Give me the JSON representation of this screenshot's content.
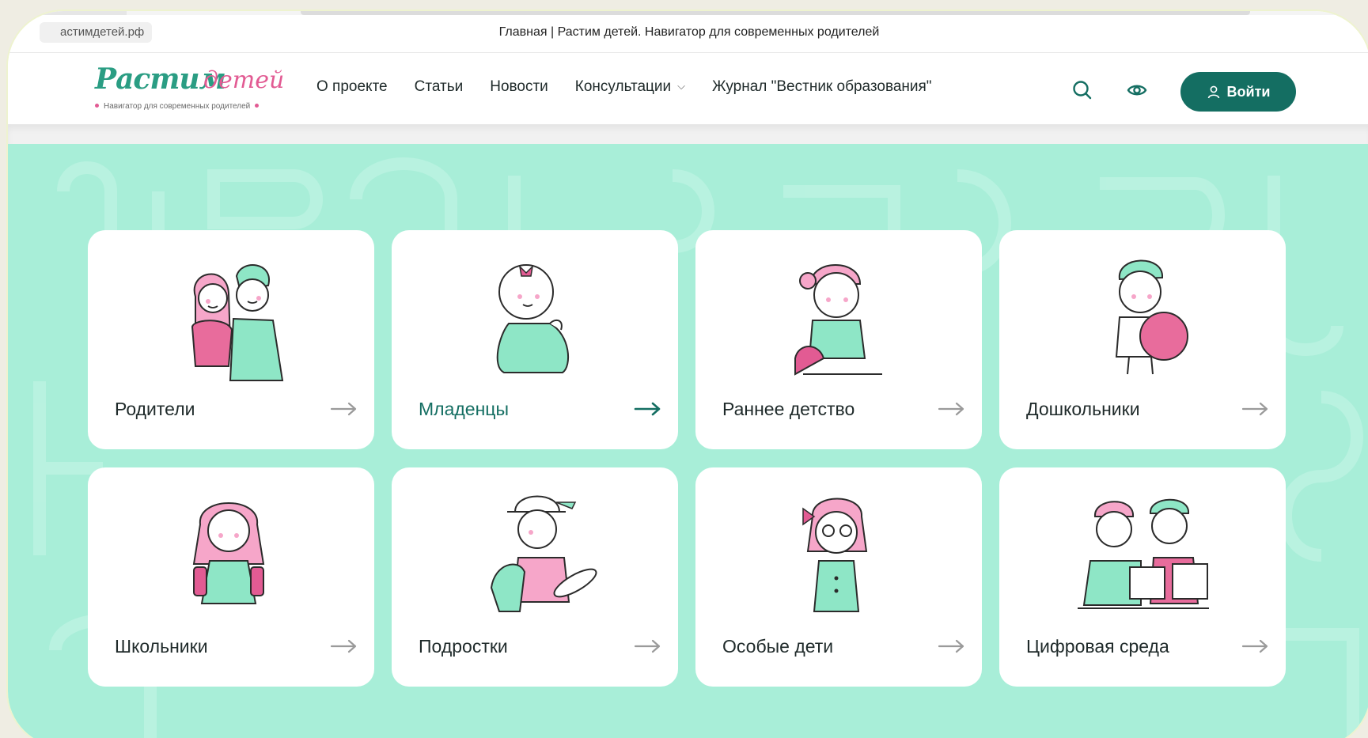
{
  "browser": {
    "url": "астимдетей.рф",
    "title": "Главная | Растим детей. Навигатор для современных родителей"
  },
  "logo": {
    "main": "Растим",
    "accent": "детей",
    "tagline": "Навигатор для современных родителей"
  },
  "nav": {
    "items": [
      "О проекте",
      "Статьи",
      "Новости",
      "Консультации",
      "Журнал \"Вестник образования\""
    ],
    "dropdown_index": 3
  },
  "header": {
    "search_icon": "search-icon",
    "accessibility_icon": "eye-icon",
    "login_label": "Войти"
  },
  "colors": {
    "brand_dark": "#146e62",
    "brand_green": "#2a9d83",
    "brand_pink": "#e25b93",
    "mint": "#a8eed8",
    "mint_char": "#8ee6c6",
    "pink_char": "#f6a6c9"
  },
  "categories": [
    {
      "label": "Родители",
      "icon": "parents-illustration",
      "active": false
    },
    {
      "label": "Младенцы",
      "icon": "baby-illustration",
      "active": true
    },
    {
      "label": "Раннее детство",
      "icon": "toddler-illustration",
      "active": false
    },
    {
      "label": "Дошкольники",
      "icon": "preschooler-illustration",
      "active": false
    },
    {
      "label": "Школьники",
      "icon": "schoolgirl-illustration",
      "active": false
    },
    {
      "label": "Подростки",
      "icon": "teenager-illustration",
      "active": false
    },
    {
      "label": "Особые дети",
      "icon": "special-child-illustration",
      "active": false
    },
    {
      "label": "Цифровая среда",
      "icon": "digital-illustration",
      "active": false
    }
  ]
}
